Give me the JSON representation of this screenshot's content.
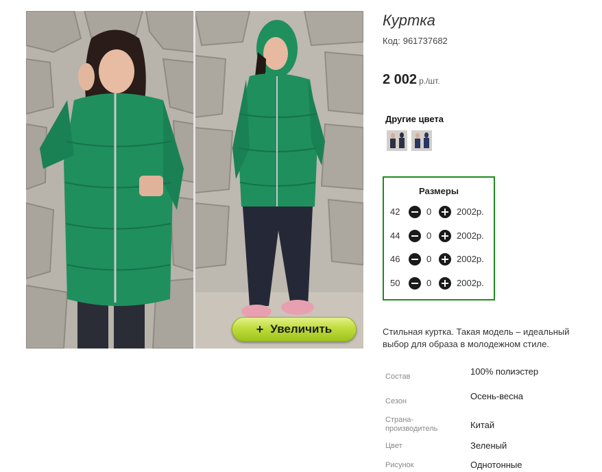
{
  "product": {
    "title": "Куртка",
    "code_label": "Код:",
    "code_value": "961737682",
    "price_value": "2 002",
    "price_unit": "р./шт."
  },
  "gallery": {
    "zoom_label": "Увеличить",
    "zoom_plus": "+"
  },
  "colors": {
    "title": "Другие цвета",
    "swatches": [
      {
        "name": "dark-navy",
        "color": "#2b3146"
      },
      {
        "name": "navy",
        "color": "#283666"
      }
    ]
  },
  "sizes": {
    "title": "Размеры",
    "rows": [
      {
        "size": "42",
        "qty": "0",
        "price": "2002р."
      },
      {
        "size": "44",
        "qty": "0",
        "price": "2002р."
      },
      {
        "size": "46",
        "qty": "0",
        "price": "2002р."
      },
      {
        "size": "50",
        "qty": "0",
        "price": "2002р."
      }
    ]
  },
  "description": "Стильная куртка. Такая модель – идеальный выбор для образа в молодежном стиле.",
  "specs": [
    {
      "label": "Состав",
      "value": "100% полиэстер"
    },
    {
      "label": "Сезон",
      "value": "Осень-весна"
    },
    {
      "label": "Страна-производитель",
      "value": "Китай"
    },
    {
      "label": "Цвет",
      "value": "Зеленый"
    },
    {
      "label": "Рисунок",
      "value": "Однотонные"
    }
  ],
  "theme": {
    "accent_green": "#1e8a1e",
    "jacket_green": "#1f8f5e",
    "zoom_button": "#b5d42c"
  }
}
